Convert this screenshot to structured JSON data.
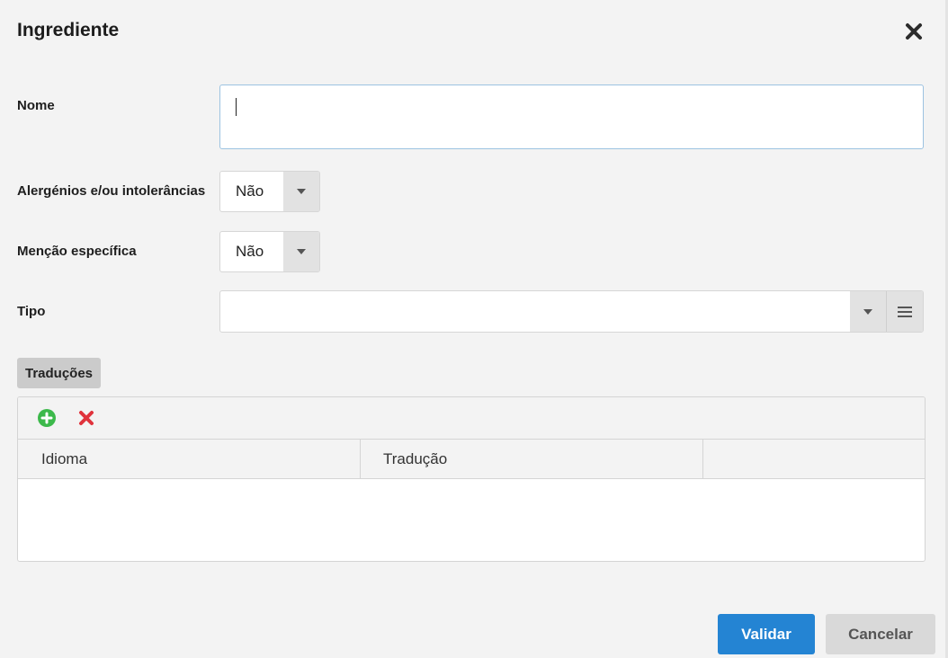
{
  "dialog": {
    "title": "Ingrediente"
  },
  "form": {
    "nome": {
      "label": "Nome",
      "value": ""
    },
    "alergenios": {
      "label": "Alergénios e/ou intolerâncias",
      "value": "Não"
    },
    "mencao": {
      "label": "Menção específica",
      "value": "Não"
    },
    "tipo": {
      "label": "Tipo",
      "value": ""
    }
  },
  "translations": {
    "tab_label": "Traduções",
    "columns": [
      "Idioma",
      "Tradução",
      ""
    ],
    "rows": []
  },
  "actions": {
    "validate": "Validar",
    "cancel": "Cancelar"
  },
  "colors": {
    "primary": "#2484d3",
    "add": "#3cb94b",
    "delete": "#e0333c"
  },
  "icons": {
    "close": "close-icon",
    "add": "add-circle-icon",
    "delete": "delete-x-icon",
    "dropdown": "chevron-down-icon",
    "list": "list-icon"
  }
}
